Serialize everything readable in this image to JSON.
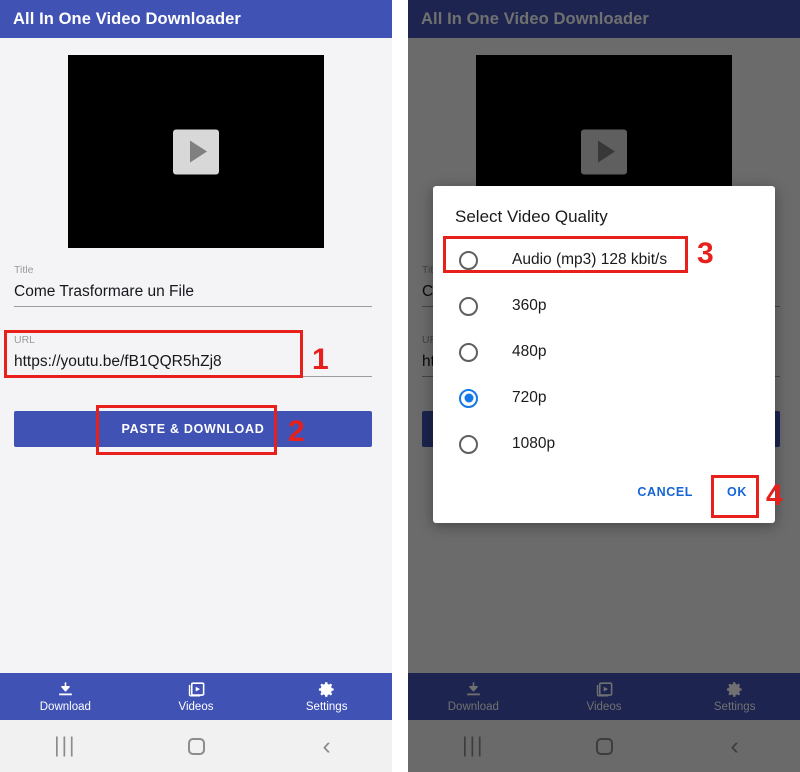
{
  "app": {
    "title": "All In One Video Downloader"
  },
  "left_screen": {
    "thumbnail": {
      "play_icon": "play-icon"
    },
    "title_field": {
      "label": "Title",
      "value": "Come Trasformare un File"
    },
    "url_field": {
      "label": "URL",
      "value": "https://youtu.be/fB1QQR5hZj8"
    },
    "paste_download_button": "PASTE & DOWNLOAD"
  },
  "bottom_nav": {
    "items": [
      {
        "label": "Download",
        "icon": "download-icon"
      },
      {
        "label": "Videos",
        "icon": "video-library-icon"
      },
      {
        "label": "Settings",
        "icon": "gear-icon"
      }
    ]
  },
  "system_nav": {
    "recents": "|||",
    "home": "home-icon",
    "back": "‹"
  },
  "dialog": {
    "title": "Select Video Quality",
    "options": [
      {
        "label": "Audio (mp3) 128 kbit/s",
        "selected": false
      },
      {
        "label": "360p",
        "selected": false
      },
      {
        "label": "480p",
        "selected": false
      },
      {
        "label": "720p",
        "selected": true
      },
      {
        "label": "1080p",
        "selected": false
      }
    ],
    "cancel_label": "CANCEL",
    "ok_label": "OK"
  },
  "annotations": [
    {
      "number": "1",
      "target": "url-field"
    },
    {
      "number": "2",
      "target": "paste-download-button"
    },
    {
      "number": "3",
      "target": "audio-mp3-option"
    },
    {
      "number": "4",
      "target": "ok-button"
    }
  ],
  "colors": {
    "primary": "#4052b4",
    "accent_blue": "#1478e8",
    "annotation_red": "#e8201c",
    "dialog_action": "#1565d8"
  }
}
